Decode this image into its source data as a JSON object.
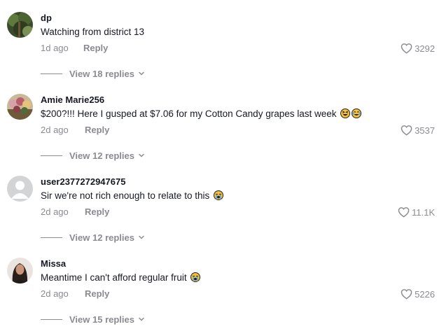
{
  "comments": [
    {
      "username": "dp",
      "text": "Watching from district 13",
      "time": "1d ago",
      "reply_label": "Reply",
      "likes": "3292",
      "view_replies": "View 18 replies",
      "avatar": "forest-photo"
    },
    {
      "username": "Amie Marie256",
      "text": "$200?!!! Here I gusped at $7.06 for my Cotton Candy grapes last week",
      "emojis": [
        "grinning-squinting-face",
        "tears-of-joy-face"
      ],
      "time": "2d ago",
      "reply_label": "Reply",
      "likes": "3537",
      "view_replies": "View 12 replies",
      "avatar": "flowers-photo"
    },
    {
      "username": "user2377272947675",
      "text": "Sir we're not rich enough to relate to this",
      "emojis": [
        "loudly-crying-face"
      ],
      "time": "2d ago",
      "reply_label": "Reply",
      "likes": "11.1K",
      "view_replies": "View 12 replies",
      "avatar": "default-avatar"
    },
    {
      "username": "Missa",
      "text": "Meantime I can't afford regular fruit",
      "emojis": [
        "loudly-crying-face"
      ],
      "time": "2d ago",
      "reply_label": "Reply",
      "likes": "5226",
      "view_replies": "View 15 replies",
      "avatar": "portrait-photo"
    }
  ],
  "colors": {
    "primary_text": "#161823",
    "secondary_text": "#8a8b91",
    "background": "#ffffff"
  },
  "icons": {
    "like": "heart-outline-icon",
    "expand": "chevron-down-icon"
  }
}
